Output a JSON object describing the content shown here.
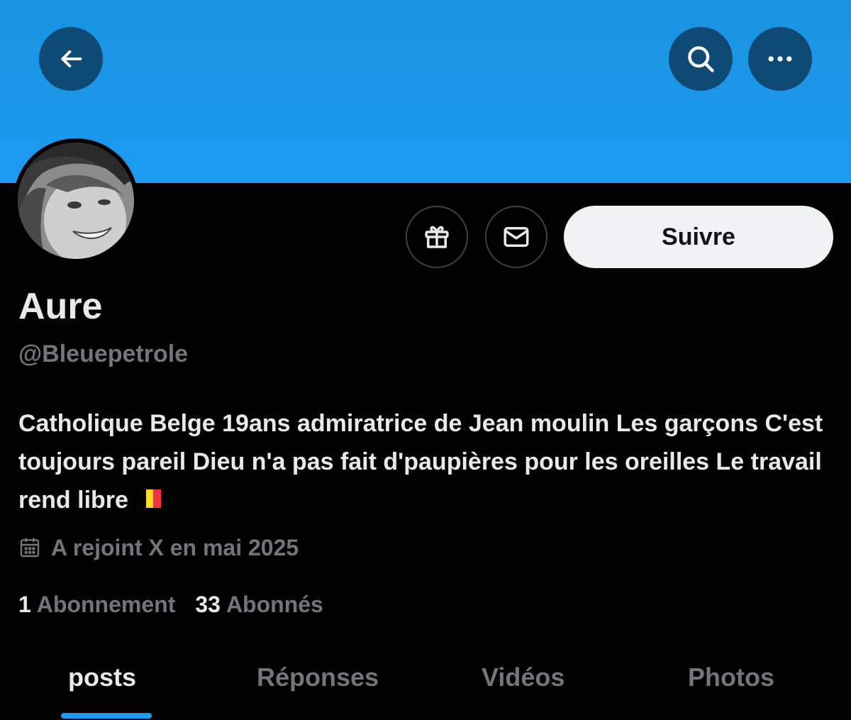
{
  "colors": {
    "banner": "#1d9bf0",
    "accent": "#1d9bf0",
    "background": "#000000",
    "primary_text": "#e7e9ea",
    "secondary_text": "#71767b",
    "follow_button_bg": "#eff3f4"
  },
  "header": {
    "back_icon": "arrow-left-icon",
    "search_icon": "search-icon",
    "more_icon": "more-horizontal-icon"
  },
  "actions": {
    "gift_icon": "gift-icon",
    "dm_icon": "envelope-icon",
    "follow_label": "Suivre"
  },
  "profile": {
    "display_name": "Aure",
    "handle": "@Bleuepetrole",
    "bio": "Catholique Belge 19ans admiratrice de Jean moulin Les garçons C'est toujours pareil Dieu n'a pas fait d'paupières pour les oreilles Le travail rend libre",
    "bio_flag": "belgium-flag",
    "joined": "A rejoint X en mai 2025",
    "joined_icon": "calendar-icon",
    "following_count": "1",
    "following_label": "Abonnement",
    "followers_count": "33",
    "followers_label": "Abonnés"
  },
  "tabs": [
    {
      "label": "posts",
      "active": true
    },
    {
      "label": "Réponses",
      "active": false
    },
    {
      "label": "Vidéos",
      "active": false
    },
    {
      "label": "Photos",
      "active": false
    }
  ]
}
